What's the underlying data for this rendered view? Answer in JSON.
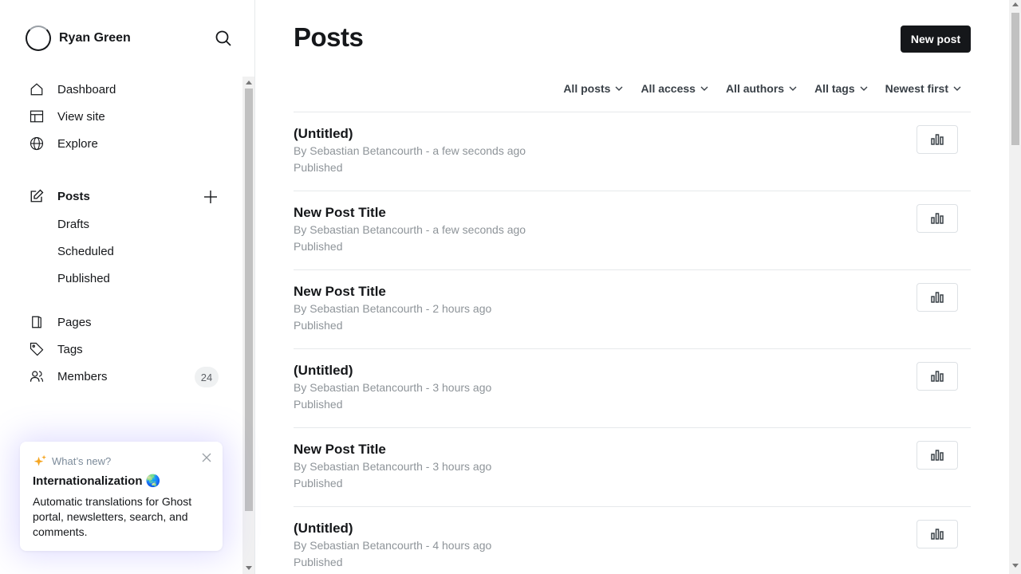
{
  "sidebar": {
    "site_title": "Ryan Green",
    "nav": {
      "dashboard": "Dashboard",
      "view_site": "View site",
      "explore": "Explore",
      "posts": "Posts",
      "drafts": "Drafts",
      "scheduled": "Scheduled",
      "published": "Published",
      "pages": "Pages",
      "tags": "Tags",
      "members": "Members",
      "members_count": "24"
    },
    "whats_new": {
      "label": "What’s new?",
      "title": "Internationalization 🌏",
      "body": "Automatic translations for Ghost portal, newsletters, search, and comments."
    }
  },
  "main": {
    "title": "Posts",
    "new_post_label": "New post",
    "filters": {
      "type": "All posts",
      "access": "All access",
      "authors": "All authors",
      "tags": "All tags",
      "order": "Newest first"
    },
    "posts": [
      {
        "title": "(Untitled)",
        "meta": "By Sebastian Betancourth - a few seconds ago",
        "status": "Published"
      },
      {
        "title": "New Post Title",
        "meta": "By Sebastian Betancourth - a few seconds ago",
        "status": "Published"
      },
      {
        "title": "New Post Title",
        "meta": "By Sebastian Betancourth - 2 hours ago",
        "status": "Published"
      },
      {
        "title": "(Untitled)",
        "meta": "By Sebastian Betancourth - 3 hours ago",
        "status": "Published"
      },
      {
        "title": "New Post Title",
        "meta": "By Sebastian Betancourth - 3 hours ago",
        "status": "Published"
      },
      {
        "title": "(Untitled)",
        "meta": "By Sebastian Betancourth - 4 hours ago",
        "status": "Published"
      }
    ]
  },
  "colors": {
    "accent_dark": "#15171a",
    "muted_text": "#8e9499",
    "border": "#e6e9eb"
  }
}
